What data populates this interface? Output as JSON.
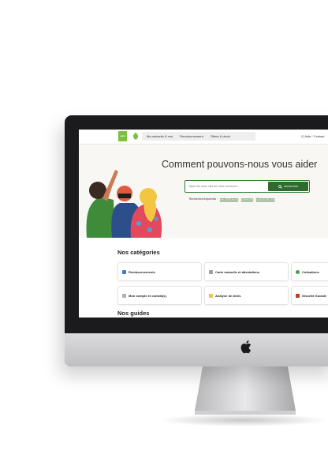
{
  "nav": {
    "logo": "ugm",
    "items": [
      "Ma mutuelle & moi",
      "Remboursement",
      "Offres & devis"
    ],
    "aide": "Aide / Contact"
  },
  "hero": {
    "title": "Comment pouvons-nous vous aider",
    "search_placeholder": "Tapez les mots clés de votre recherche",
    "search_button": "rechercher",
    "frequent_label": "Recherches fréquentes :",
    "frequent": [
      "remboursement",
      "connexion",
      "télétransmission"
    ]
  },
  "categories": {
    "title": "Nos catégories",
    "items": [
      "Remboursements",
      "Carte mutuelle et attestations",
      "Cotisations",
      "Mon compte et contrat(s)",
      "Analyse de devis",
      "Sécurité Sociale"
    ]
  },
  "guides": {
    "title": "Nos guides"
  },
  "colors": {
    "brand": "#7ac142",
    "accent": "#2e6b2e"
  }
}
